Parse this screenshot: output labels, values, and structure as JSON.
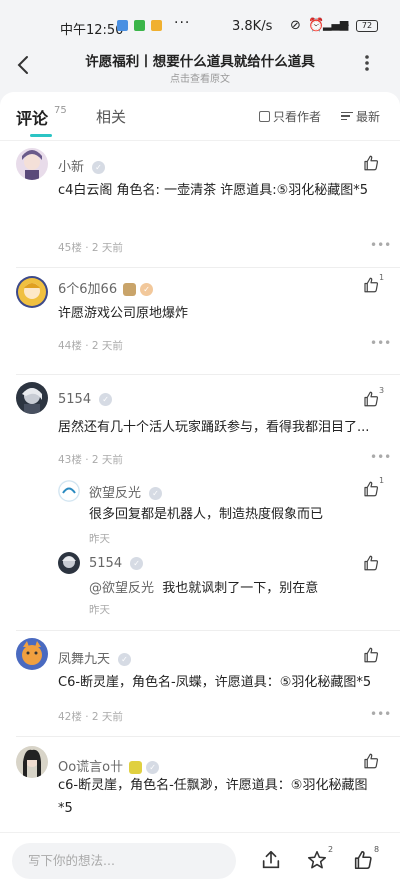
{
  "status_bar": {
    "time": "中午12:50",
    "dots": "···",
    "net_speed": "3.8K/s",
    "battery": "72"
  },
  "header": {
    "title": "许愿福利丨想要什么道具就给什么道具",
    "subtitle": "点击查看原文"
  },
  "tabs": {
    "comments_label": "评论",
    "comments_count": "75",
    "related_label": "相关",
    "only_author_label": "只看作者",
    "sort_label": "最新"
  },
  "comments": [
    {
      "name": "小新",
      "text": "c4白云阁  角色名:    一壶清茶    许愿道具:⑤羽化秘藏图*5",
      "floor": "45楼",
      "time": "2 天前",
      "likes": ""
    },
    {
      "name": "6个6加66",
      "text": "许愿游戏公司原地爆炸",
      "floor": "44楼",
      "time": "2 天前",
      "likes": "1"
    },
    {
      "name": "5154",
      "text": "居然还有几十个活人玩家踊跃参与，看得我都泪目了...",
      "floor": "43楼",
      "time": "2 天前",
      "likes": "3",
      "replies": [
        {
          "name": "欲望反光",
          "text": "很多回复都是机器人，制造热度假象而已",
          "time": "昨天",
          "likes": "1"
        },
        {
          "name": "5154",
          "at": "@欲望反光",
          "text": "我也就讽刺了一下，别在意",
          "time": "昨天",
          "likes": ""
        }
      ]
    },
    {
      "name": "凤舞九天",
      "text": "C6-断灵崖，角色名-凤蝶，许愿道具：⑤羽化秘藏图*5",
      "floor": "42楼",
      "time": "2 天前",
      "likes": ""
    },
    {
      "name": "Oo谎言o卄",
      "text": "c6-断灵崖，角色名-任飘渺，许愿道具：⑤羽化秘藏图*5",
      "floor": "",
      "time": "",
      "likes": ""
    }
  ],
  "meta_sep": "·",
  "bottom_bar": {
    "placeholder": "写下你的想法...",
    "star_count": "2",
    "like_count": "8"
  },
  "colors": {
    "accent": "#2bc4c4",
    "page_bg": "#f3f4f6"
  },
  "icons": [
    "back-arrow-icon",
    "more-vertical-icon",
    "thumb-up-icon",
    "share-icon",
    "star-icon",
    "ellipsis-icon"
  ]
}
